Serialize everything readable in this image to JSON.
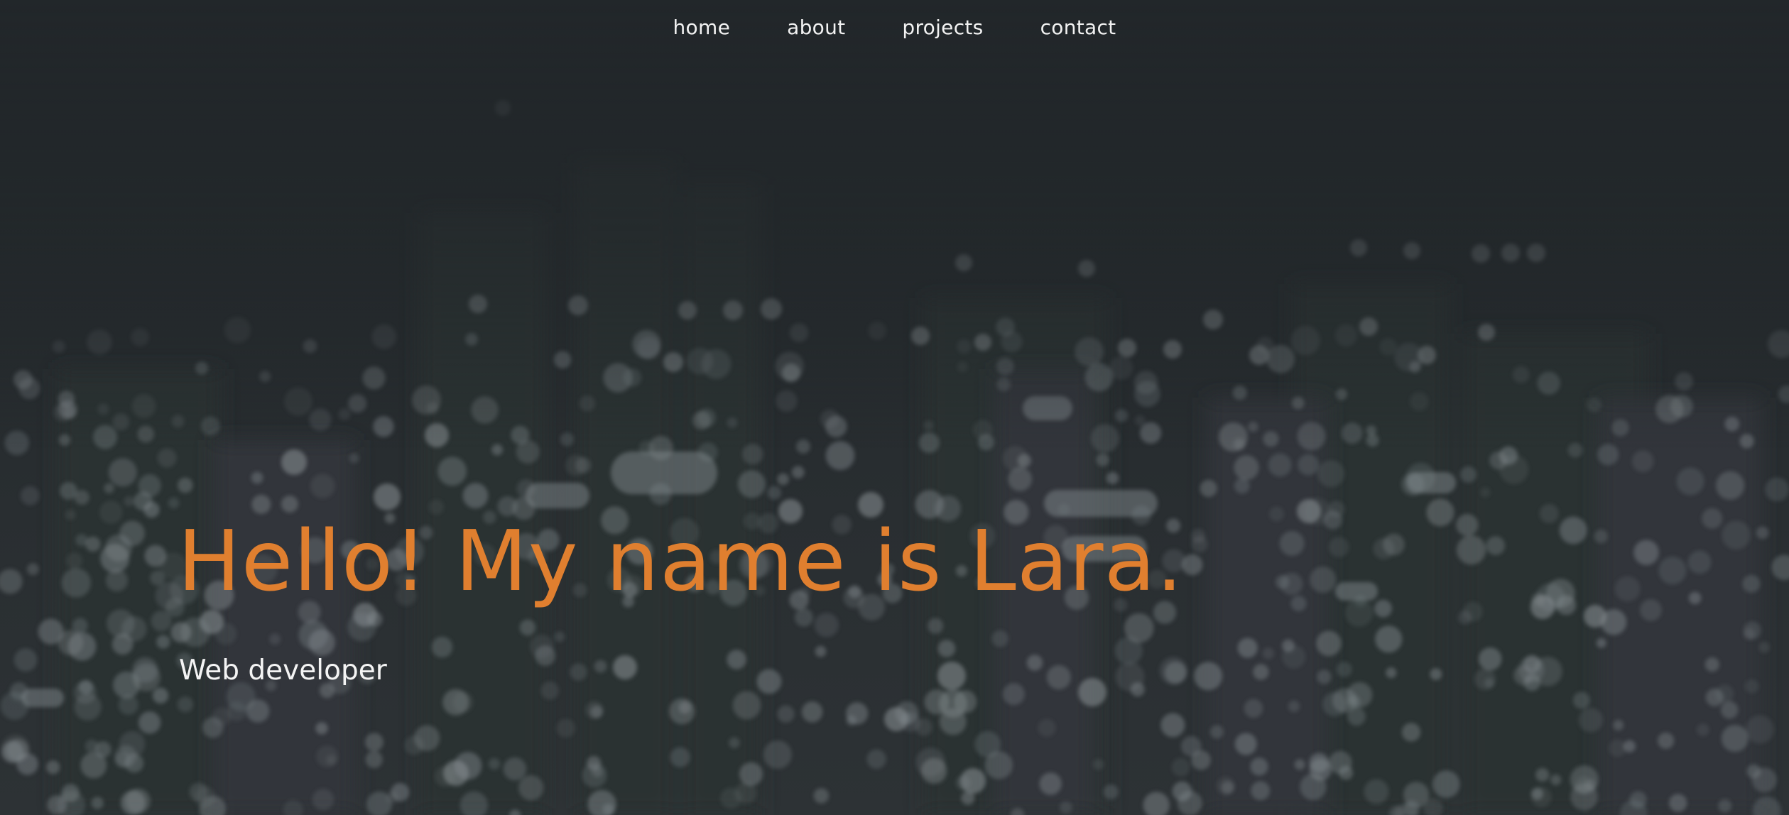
{
  "nav": {
    "items": [
      "home",
      "about",
      "projects",
      "contact"
    ]
  },
  "hero": {
    "headline": "Hello! My name is Lara.",
    "subtitle": "Web developer"
  },
  "colors": {
    "background": "#23282b",
    "accent": "#e07f2f",
    "text": "#f4f4f4"
  }
}
